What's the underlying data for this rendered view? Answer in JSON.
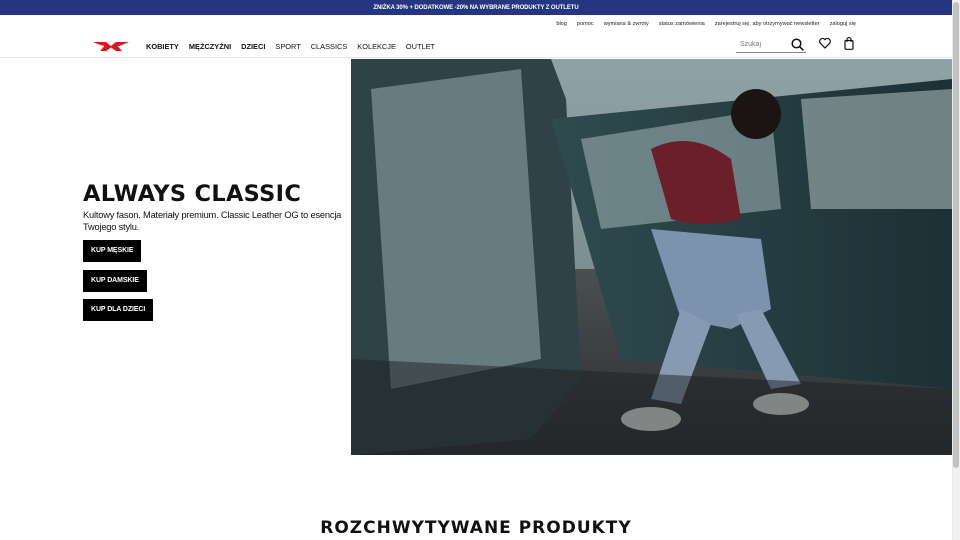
{
  "promo": {
    "text": "ZNIŻKA 30% + DODATKOWE -20% NA WYBRANE PRODUKTY Z OUTLETU"
  },
  "utility_links": [
    "blog",
    "pomoc",
    "wymiana & zwroty",
    "status zamówienia",
    "zarejestruj się, aby otrzymywać newsletter",
    "zaloguj się"
  ],
  "nav": {
    "items": [
      {
        "label": "KOBIETY"
      },
      {
        "label": "MĘŻCZYŹNI"
      },
      {
        "label": "DZIECI"
      },
      {
        "label": "SPORT"
      },
      {
        "label": "CLASSICS"
      },
      {
        "label": "KOLEKCJE"
      },
      {
        "label": "OUTLET"
      }
    ],
    "search_placeholder": "Szukaj"
  },
  "hero": {
    "title": "ALWAYS CLASSIC",
    "description": "Kultowy fason. Materiały premium. Classic Leather OG to esencja Twojego stylu.",
    "buttons": [
      "KUP MĘSKIE",
      "KUP DAMSKIE",
      "KUP DLA DZIECI"
    ]
  },
  "section": {
    "title": "ROZCHWYTYWANE PRODUKTY"
  },
  "colors": {
    "promo_bg": "#253581",
    "logo_red": "#d9161d",
    "button_bg": "#000000"
  }
}
